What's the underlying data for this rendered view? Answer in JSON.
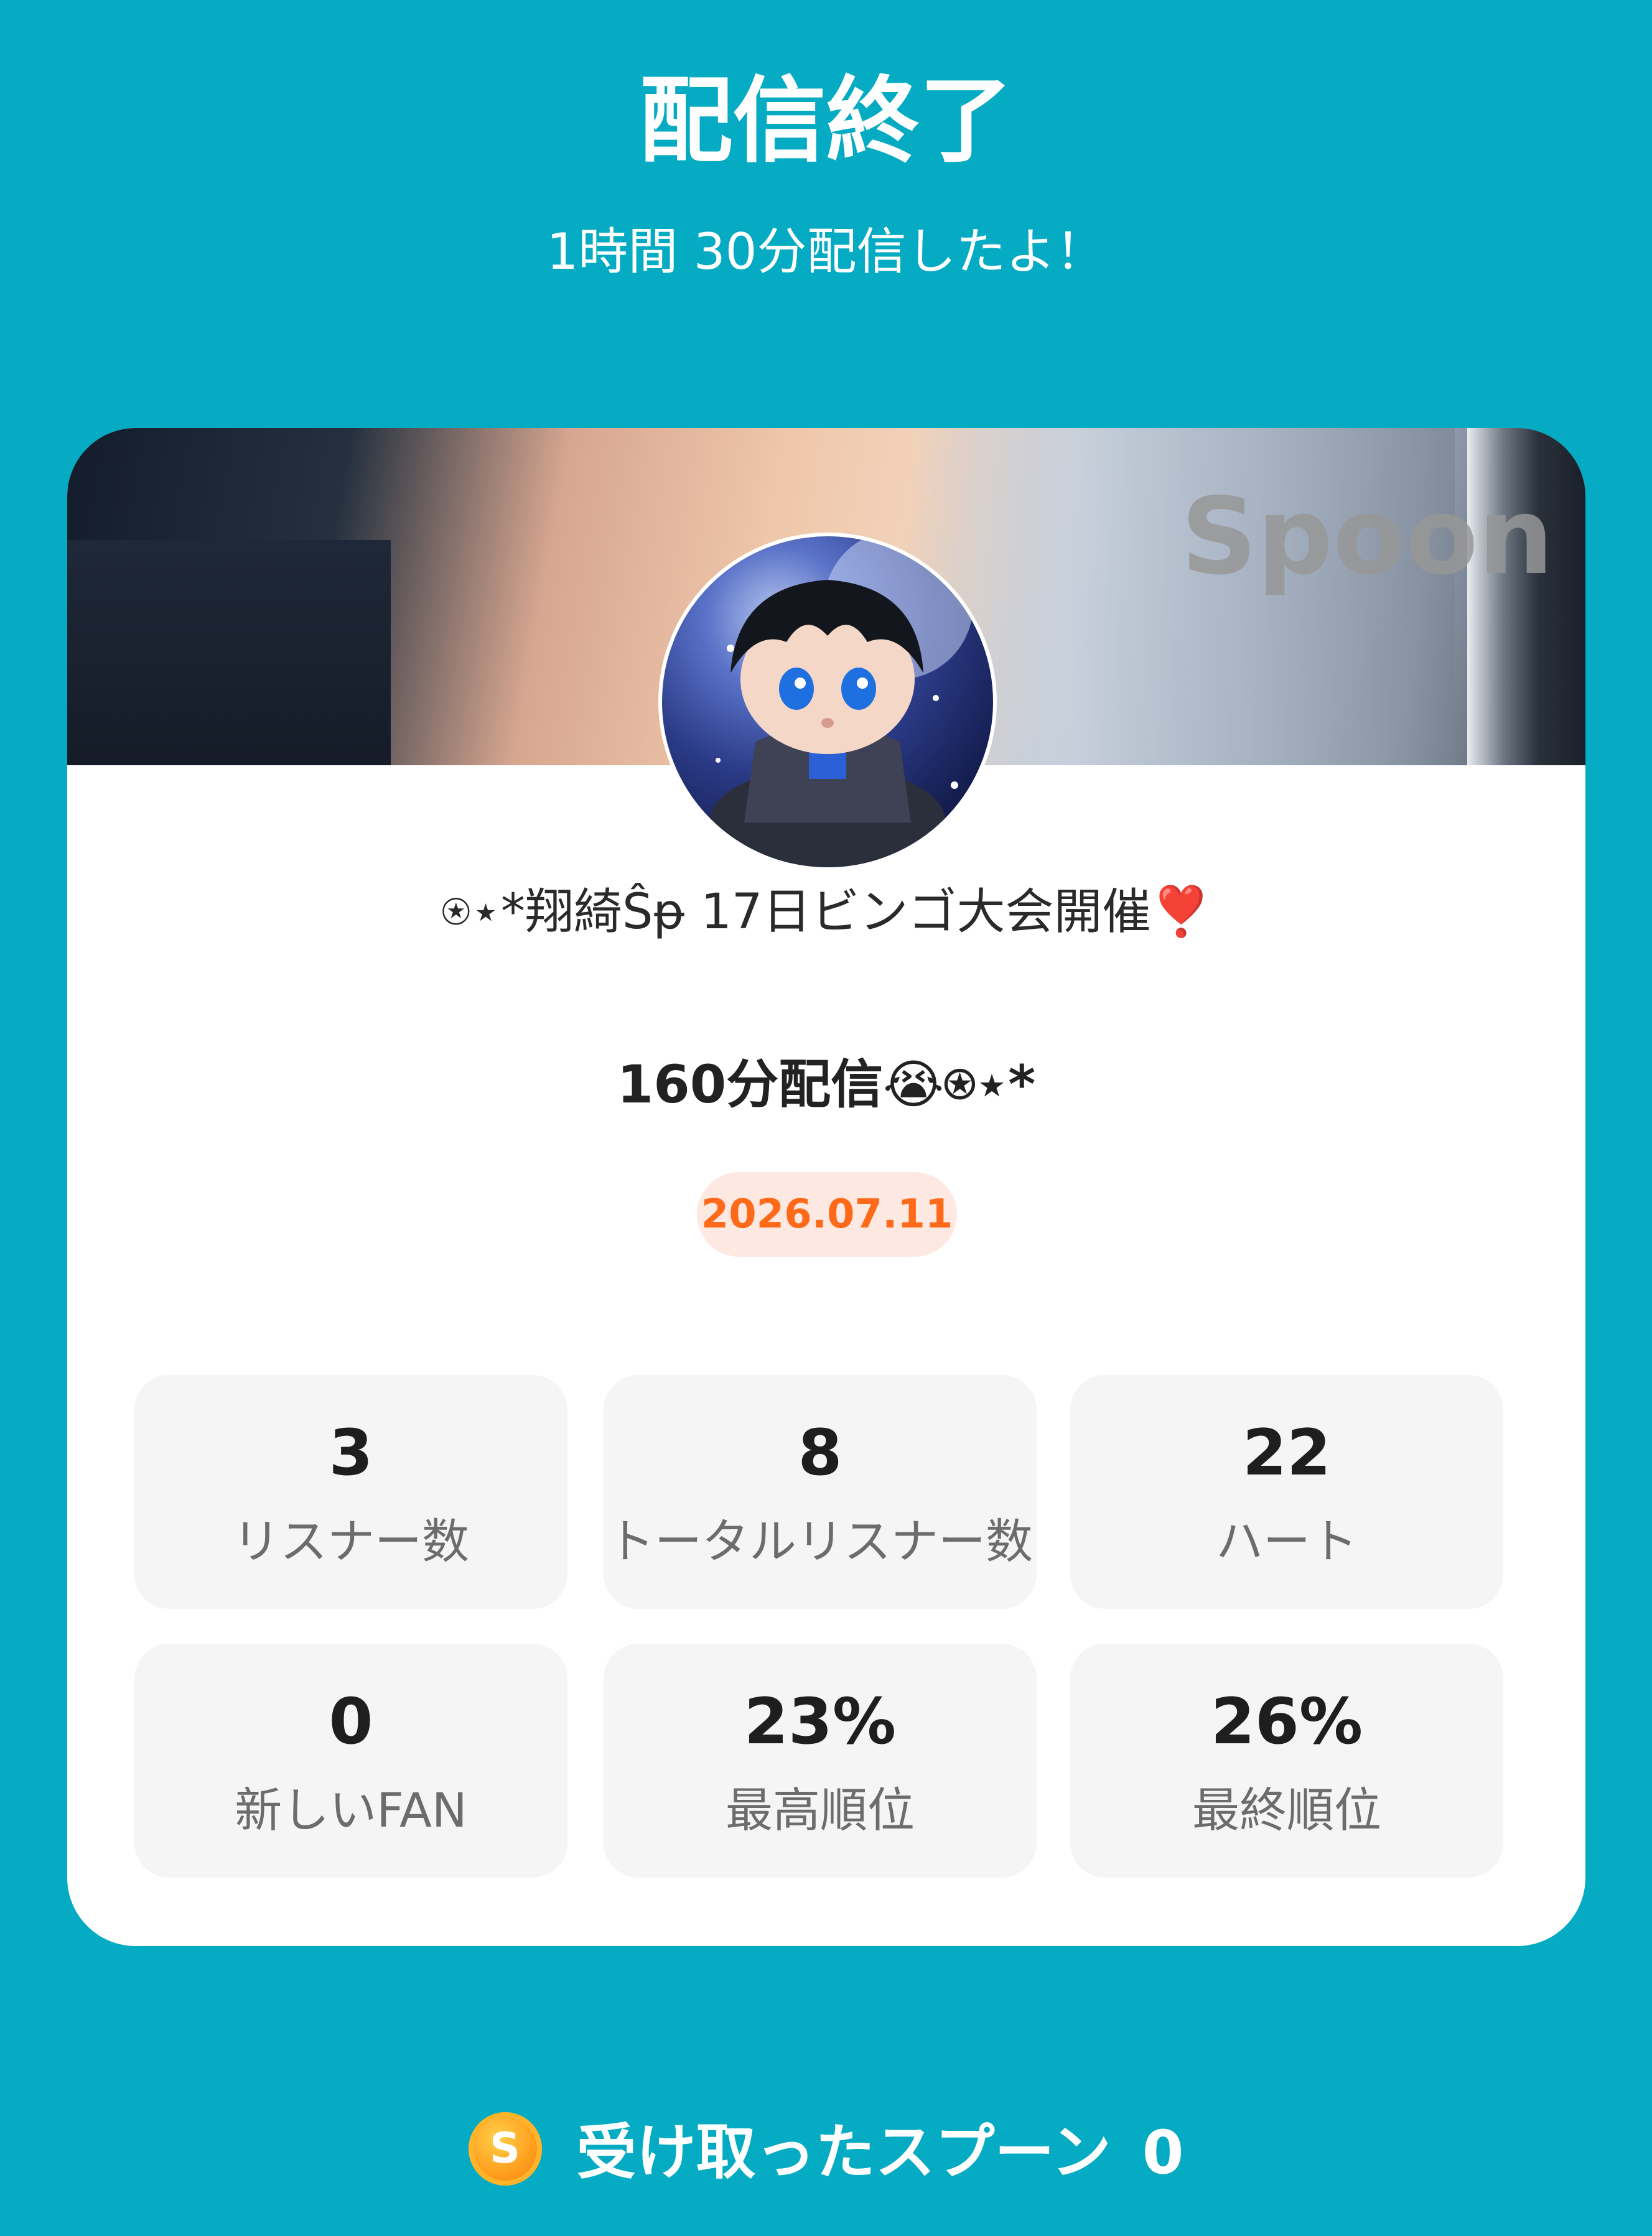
{
  "header": {
    "title": "配信終了",
    "subtitle": "1時間 30分配信したよ！"
  },
  "card": {
    "banner_watermark": "Spoon",
    "channel_name": "⍟⋆*翔綺Ŝᵽ 17日ビンゴ大会開催❣️",
    "stream_title": "160分配信😭⍟⋆*",
    "date": "2026.07.11",
    "stats": [
      {
        "value": "3",
        "label": "リスナー数"
      },
      {
        "value": "8",
        "label": "トータルリスナー数"
      },
      {
        "value": "22",
        "label": "ハート"
      },
      {
        "value": "0",
        "label": "新しいFAN"
      },
      {
        "value": "23%",
        "label": "最高順位"
      },
      {
        "value": "26%",
        "label": "最終順位"
      }
    ]
  },
  "footer": {
    "spoon_icon": "spoon-coin-icon",
    "coin_letter": "S",
    "received_label": "受け取ったスプーン",
    "received_count": "0"
  },
  "colors": {
    "background": "#04abc3",
    "card": "#ffffff",
    "stat_tile": "#f5f5f5",
    "date_text": "#ff6a1a",
    "date_badge_bg": "#fde9e2"
  }
}
